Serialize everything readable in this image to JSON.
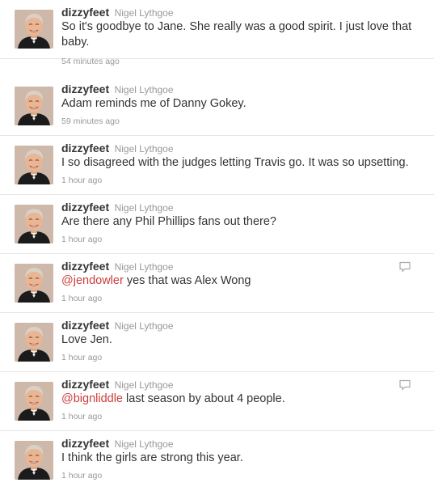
{
  "colors": {
    "mention": "#cc3d3d",
    "meta": "#999999",
    "text": "#333333",
    "divider": "#e6e6e6"
  },
  "tweets": [
    {
      "username": "dizzyfeet",
      "realname": "Nigel Lythgoe",
      "mention": "",
      "text": "So it's goodbye to Jane. She really was a good spirit. I just love that baby.",
      "time": "54 minutes ago",
      "reply": false
    },
    {
      "username": "dizzyfeet",
      "realname": "Nigel Lythgoe",
      "mention": "",
      "text": "Adam reminds me of Danny Gokey.",
      "time": "59 minutes ago",
      "reply": false
    },
    {
      "username": "dizzyfeet",
      "realname": "Nigel Lythgoe",
      "mention": "",
      "text": "I so disagreed with the judges letting Travis go. It was so upsetting.",
      "time": "1 hour ago",
      "reply": false
    },
    {
      "username": "dizzyfeet",
      "realname": "Nigel Lythgoe",
      "mention": "",
      "text": "Are there any Phil Phillips fans out there?",
      "time": "1 hour ago",
      "reply": false
    },
    {
      "username": "dizzyfeet",
      "realname": "Nigel Lythgoe",
      "mention": "@jendowler",
      "text": " yes that was Alex Wong",
      "time": "1 hour ago",
      "reply": true,
      "reply_icon": "reply-icon"
    },
    {
      "username": "dizzyfeet",
      "realname": "Nigel Lythgoe",
      "mention": "",
      "text": "Love Jen.",
      "time": "1 hour ago",
      "reply": false
    },
    {
      "username": "dizzyfeet",
      "realname": "Nigel Lythgoe",
      "mention": "@bignliddle",
      "text": " last season by about 4 people.",
      "time": "1 hour ago",
      "reply": true,
      "reply_icon": "reply-icon"
    },
    {
      "username": "dizzyfeet",
      "realname": "Nigel Lythgoe",
      "mention": "",
      "text": "I think the girls are strong this year.",
      "time": "1 hour ago",
      "reply": false
    }
  ]
}
